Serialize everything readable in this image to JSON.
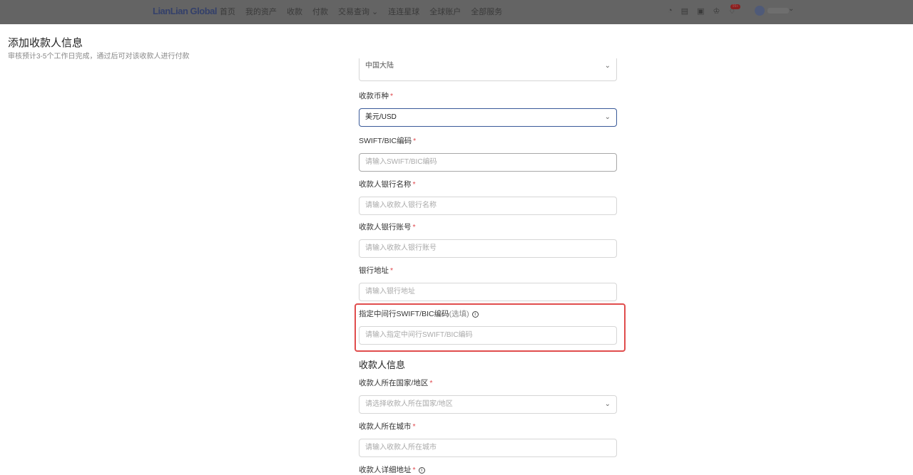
{
  "nav": {
    "logo": "LianLian Global",
    "menu": [
      "首页",
      "我的资产",
      "收款",
      "付款",
      "交易查询 ⌄",
      "连连星球",
      "全球账户",
      "全部服务"
    ],
    "badge": "99+"
  },
  "modal": {
    "title": "添加收款人信息",
    "subtitle": "审核预计3-5个工作日完成，通过后可对该收款人进行付款"
  },
  "fields": [
    {
      "value": "中国大陆"
    },
    {
      "label": "收款币种",
      "value": "美元/USD"
    },
    {
      "label": "SWIFT/BIC编码",
      "placeholder": "请输入SWIFT/BIC编码"
    },
    {
      "label": "收款人银行名称",
      "placeholder": "请输入收款人银行名称"
    },
    {
      "label": "收款人银行账号",
      "placeholder": "请输入收款人银行账号"
    },
    {
      "label": "银行地址",
      "placeholder": "请输入银行地址"
    },
    {
      "label": "指定中间行SWIFT/BIC编码",
      "optional": "(选填)",
      "placeholder": "请输入指定中间行SWIFT/BIC编码"
    }
  ],
  "section": "收款人信息",
  "fields2": [
    {
      "label": "收款人所在国家/地区",
      "placeholder": "请选择收款人所在国家/地区"
    },
    {
      "label": "收款人所在城市",
      "placeholder": "请输入收款人所在城市"
    },
    {
      "label": "收款人详细地址"
    }
  ],
  "colors": {
    "highlight": "#e04d4d",
    "required": "#e0474c",
    "focus": "#3a5a99"
  }
}
